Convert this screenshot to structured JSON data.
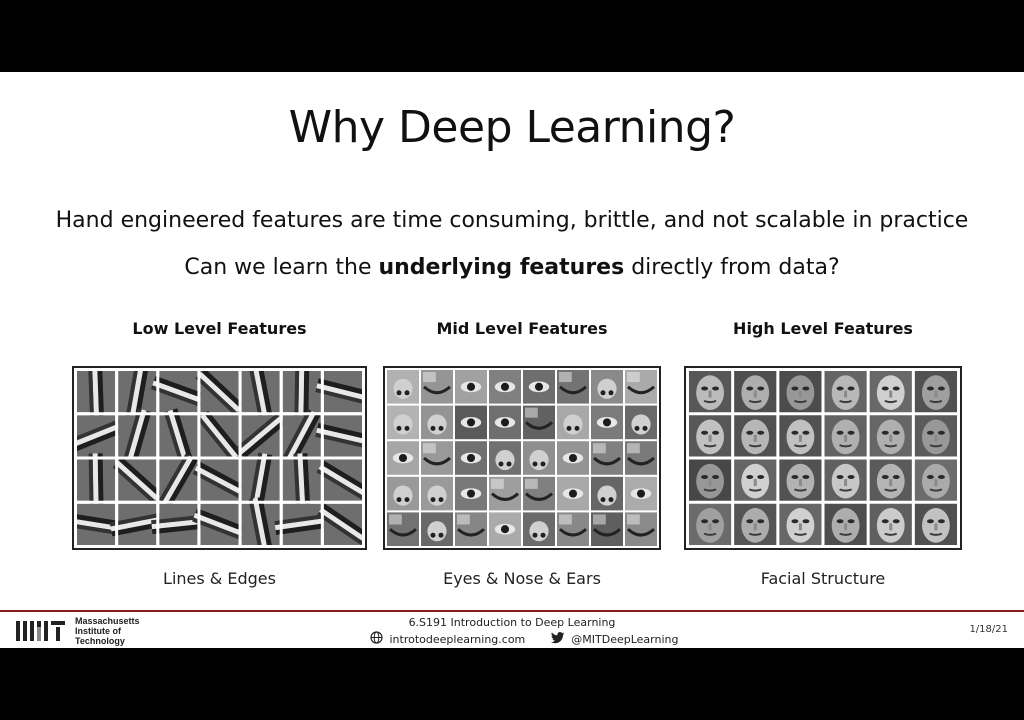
{
  "slide": {
    "title": "Why Deep Learning?",
    "line1": "Hand engineered features are time consuming, brittle, and not scalable in practice",
    "line2_prefix": "Can we learn the ",
    "line2_bold": "underlying features",
    "line2_suffix": " directly from data?",
    "columns": [
      {
        "heading": "Low Level Features",
        "caption": "Lines & Edges",
        "image": "edge-filters-grid"
      },
      {
        "heading": "Mid Level Features",
        "caption": "Eyes & Nose & Ears",
        "image": "face-parts-grid"
      },
      {
        "heading": "High Level Features",
        "caption": "Facial Structure",
        "image": "faces-grid"
      }
    ]
  },
  "footer": {
    "institution": [
      "Massachusetts",
      "Institute of",
      "Technology"
    ],
    "course": "6.S191 Introduction to Deep Learning",
    "website": "introtodeeplearning.com",
    "twitter": "@MITDeepLearning",
    "date": "1/18/21",
    "icons": [
      "globe-icon",
      "twitter-icon"
    ]
  }
}
